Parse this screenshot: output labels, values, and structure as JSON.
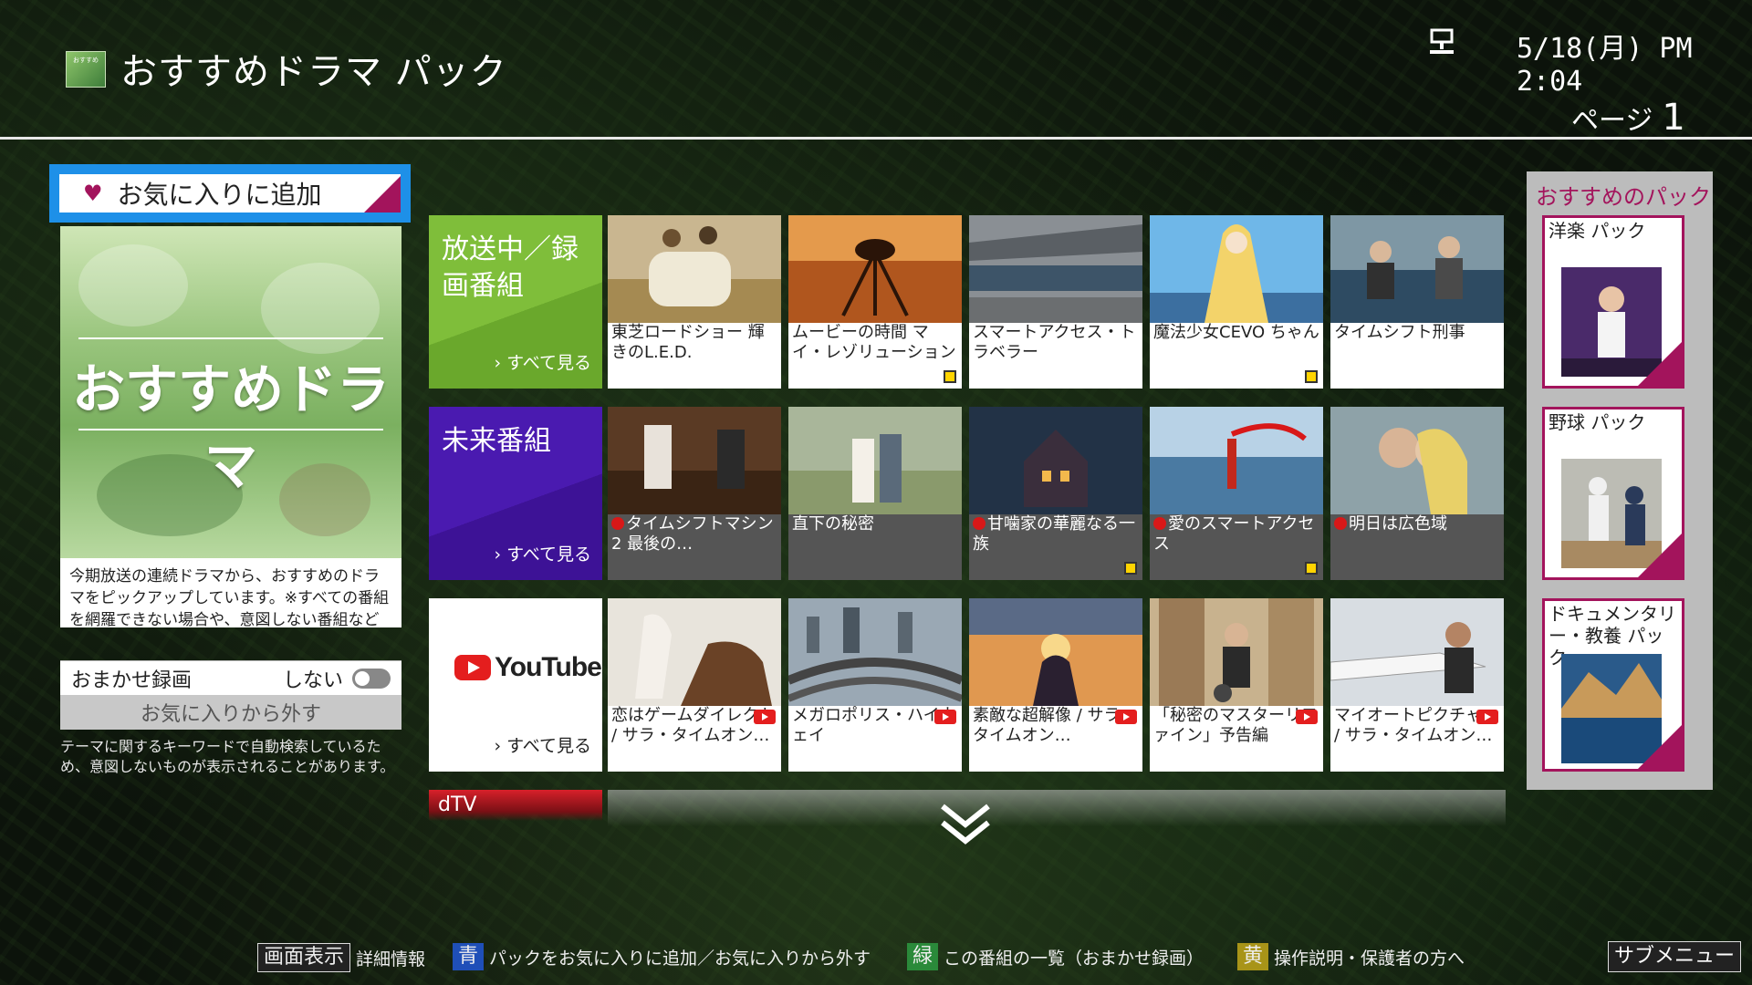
{
  "header": {
    "logo_text": "おすすめ",
    "title": "おすすめドラマ パック",
    "datetime": "5/18(月) PM 2:04",
    "page_label": "ページ",
    "page_number": "1"
  },
  "left_panel": {
    "favorite_button": "お気に入りに追加",
    "feature_title": "おすすめドラマ",
    "description": "今期放送の連続ドラマから、おすすめのドラマをピックアップしています。※すべての番組を網羅できない場合や、意図しない番組などが含まれる場合が…",
    "auto_record_label": "おまかせ録画",
    "auto_record_value": "しない",
    "remove_favorite": "お気に入りから外す",
    "note": "テーマに関するキーワードで自動検索しているため、意図しないものが表示されることがあります。"
  },
  "categories": {
    "broadcast": "放送中／録画番組",
    "future": "未来番組",
    "youtube": "YouTube",
    "dtv": "dTV",
    "see_all": "すべて見る"
  },
  "row1": [
    {
      "title": "東芝ロードショー 輝きのL.E.D.",
      "badge": false
    },
    {
      "title": "ムービーの時間 マイ・レゾリューション",
      "badge": true
    },
    {
      "title": "スマートアクセス・トラベラー",
      "badge": false
    },
    {
      "title": "魔法少女CEVO ちゃん",
      "badge": true
    },
    {
      "title": "タイムシフト刑事",
      "badge": false
    }
  ],
  "row2": [
    {
      "title": "タイムシフトマシン2 最後の…",
      "rec": true,
      "badge": false
    },
    {
      "title": "直下の秘密",
      "rec": false,
      "badge": false
    },
    {
      "title": "甘噛家の華麗なる一族",
      "rec": true,
      "badge": true
    },
    {
      "title": "愛のスマートアクセス",
      "rec": true,
      "badge": true
    },
    {
      "title": "明日は広色域",
      "rec": true,
      "badge": false
    }
  ],
  "row3": [
    {
      "title": "恋はゲームダイレクト / サラ・タイムオン…"
    },
    {
      "title": "メガロポリス・ハイウェイ"
    },
    {
      "title": "素敵な超解像 / サラ・タイムオン…"
    },
    {
      "title": "「秘密のマスターリファイン」予告編"
    },
    {
      "title": "マイオートピクチャー / サラ・タイムオン…"
    }
  ],
  "right_panel": {
    "title": "おすすめのパック",
    "packs": [
      "洋楽 パック",
      "野球 パック",
      "ドキュメンタリー・教養 パック"
    ]
  },
  "footer": {
    "display_key": "画面表示",
    "display_label": "詳細情報",
    "blue_key": "青",
    "blue_label": "パックをお気に入りに追加／お気に入りから外す",
    "green_key": "緑",
    "green_label": "この番組の一覧（おまかせ録画）",
    "yellow_key": "黄",
    "yellow_label": "操作説明・保護者の方へ",
    "submenu": "サブメニュー"
  },
  "colors": {
    "accent_magenta": "#a3145c",
    "focus_blue": "#1e90e8",
    "broadcast_green": "#7fbe3a",
    "future_purple": "#4a1ab0",
    "youtube_red": "#e41e1e",
    "dtv_red": "#d8202a"
  },
  "icons": {
    "network": "network-icon",
    "heart": "heart-icon",
    "scroll_down": "chevron-double-down-icon"
  }
}
